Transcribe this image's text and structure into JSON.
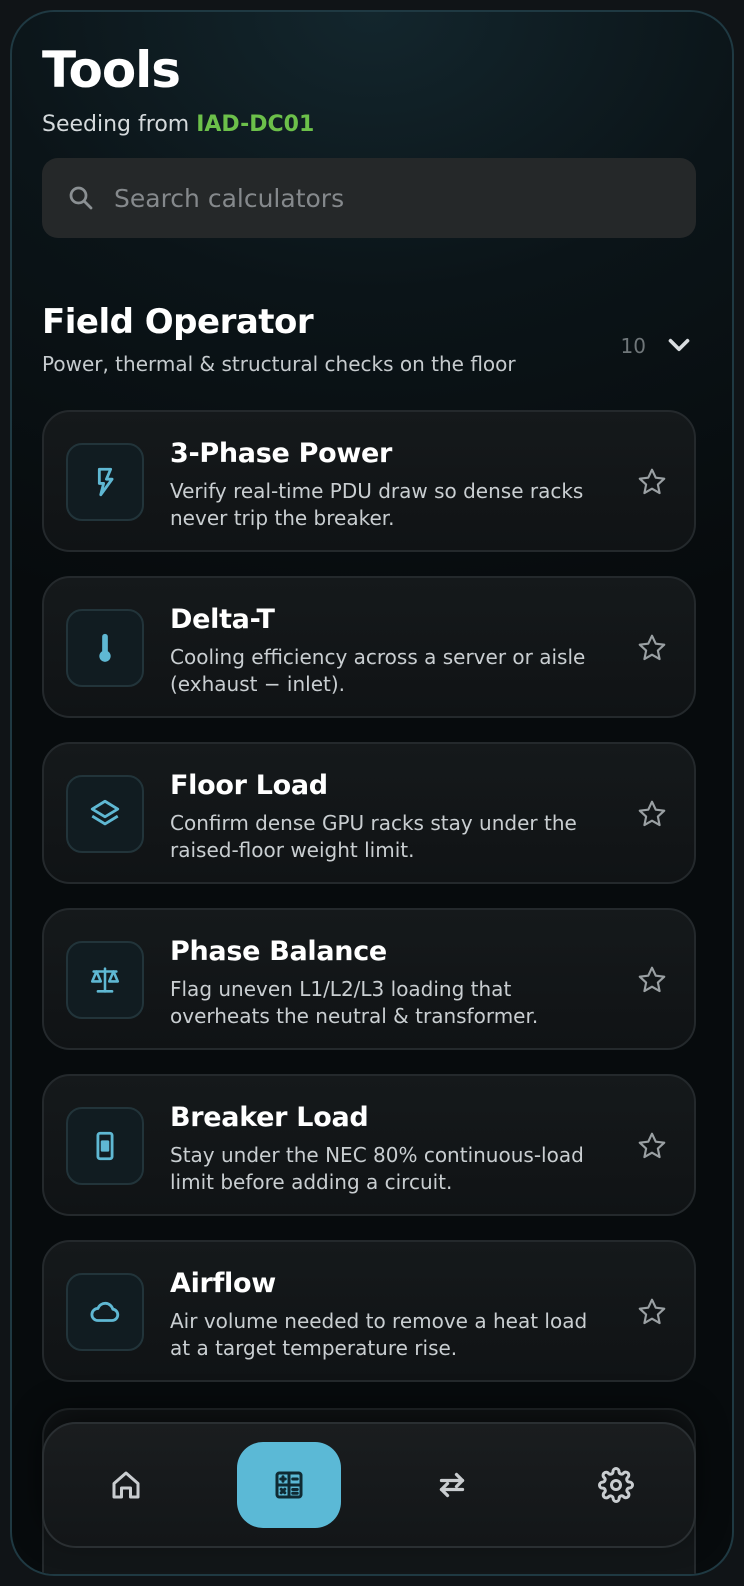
{
  "header": {
    "title": "Tools",
    "seeding_prefix": "Seeding from ",
    "seeding_site": "IAD-DC01"
  },
  "search": {
    "placeholder": "Search calculators",
    "icon": "search-icon"
  },
  "section": {
    "title": "Field Operator",
    "subtitle": "Power, thermal & structural checks on the floor",
    "count": "10",
    "expand_icon": "chevron-down-icon"
  },
  "calculators": [
    {
      "title": "3-Phase Power",
      "description": "Verify real-time PDU draw so dense racks never trip the breaker.",
      "icon": "bolt-icon",
      "favorited": false
    },
    {
      "title": "Delta-T",
      "description": "Cooling efficiency across a server or aisle (exhaust − inlet).",
      "icon": "thermometer-icon",
      "favorited": false
    },
    {
      "title": "Floor Load",
      "description": "Confirm dense GPU racks stay under the raised-floor weight limit.",
      "icon": "layers-icon",
      "favorited": false
    },
    {
      "title": "Phase Balance",
      "description": "Flag uneven L1/L2/L3 loading that overheats the neutral & transformer.",
      "icon": "scale-icon",
      "favorited": false
    },
    {
      "title": "Breaker Load",
      "description": "Stay under the NEC 80% continuous-load limit before adding a circuit.",
      "icon": "breaker-icon",
      "favorited": false
    },
    {
      "title": "Airflow",
      "description": "Air volume needed to remove a heat load at a target temperature rise.",
      "icon": "cloud-icon",
      "favorited": false
    }
  ],
  "nav": {
    "items": [
      {
        "name": "home",
        "icon": "home-icon",
        "active": false
      },
      {
        "name": "tools",
        "icon": "calculator-icon",
        "active": true
      },
      {
        "name": "transfer",
        "icon": "swap-arrows-icon",
        "active": false
      },
      {
        "name": "settings",
        "icon": "gear-icon",
        "active": false
      }
    ]
  },
  "colors": {
    "accent": "#5bb9d6",
    "site_green": "#6cc04a",
    "background": "#0b1418",
    "card": "#15191b"
  }
}
